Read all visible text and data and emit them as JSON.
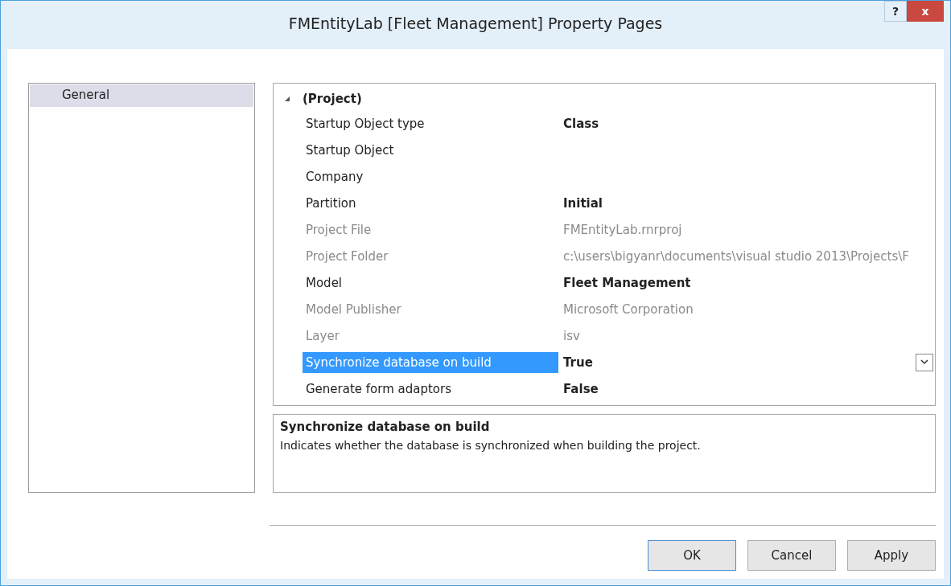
{
  "window": {
    "title": "FMEntityLab [Fleet Management] Property Pages",
    "help_button": "?",
    "close_button": "x"
  },
  "sidebar": {
    "items": [
      {
        "label": "General",
        "selected": true
      }
    ]
  },
  "property_grid": {
    "category": {
      "label": "(Project)",
      "expanded": true
    },
    "rows": [
      {
        "name": "Startup Object type",
        "value": "Class",
        "modified": true,
        "readonly": false,
        "selected": false
      },
      {
        "name": "Startup Object",
        "readonly": false,
        "selected": false
      },
      {
        "name": "Company",
        "readonly": false,
        "selected": false
      },
      {
        "name": "Partition",
        "value": "Initial",
        "modified": true,
        "readonly": false,
        "selected": false
      },
      {
        "name": "Project File",
        "value": "FMEntityLab.rnrproj",
        "modified": false,
        "readonly": true,
        "selected": false
      },
      {
        "name": "Project Folder",
        "value": "c:\\users\\bigyanr\\documents\\visual studio 2013\\Projects\\F",
        "modified": false,
        "readonly": true,
        "selected": false
      },
      {
        "name": "Model",
        "value": "Fleet Management",
        "modified": true,
        "readonly": false,
        "selected": false
      },
      {
        "name": "Model Publisher",
        "value": "Microsoft Corporation",
        "modified": false,
        "readonly": true,
        "selected": false
      },
      {
        "name": "Layer",
        "value": "isv",
        "modified": false,
        "readonly": true,
        "selected": false
      },
      {
        "name": "Synchronize database on build",
        "value": "True",
        "modified": true,
        "readonly": false,
        "selected": true
      },
      {
        "name": "Generate form adaptors",
        "value": "False",
        "modified": true,
        "readonly": false,
        "selected": false
      }
    ]
  },
  "description": {
    "title": "Synchronize database on build",
    "text": "Indicates whether the database is synchronized when building the project."
  },
  "buttons": [
    "OK",
    "Cancel",
    "Apply"
  ]
}
